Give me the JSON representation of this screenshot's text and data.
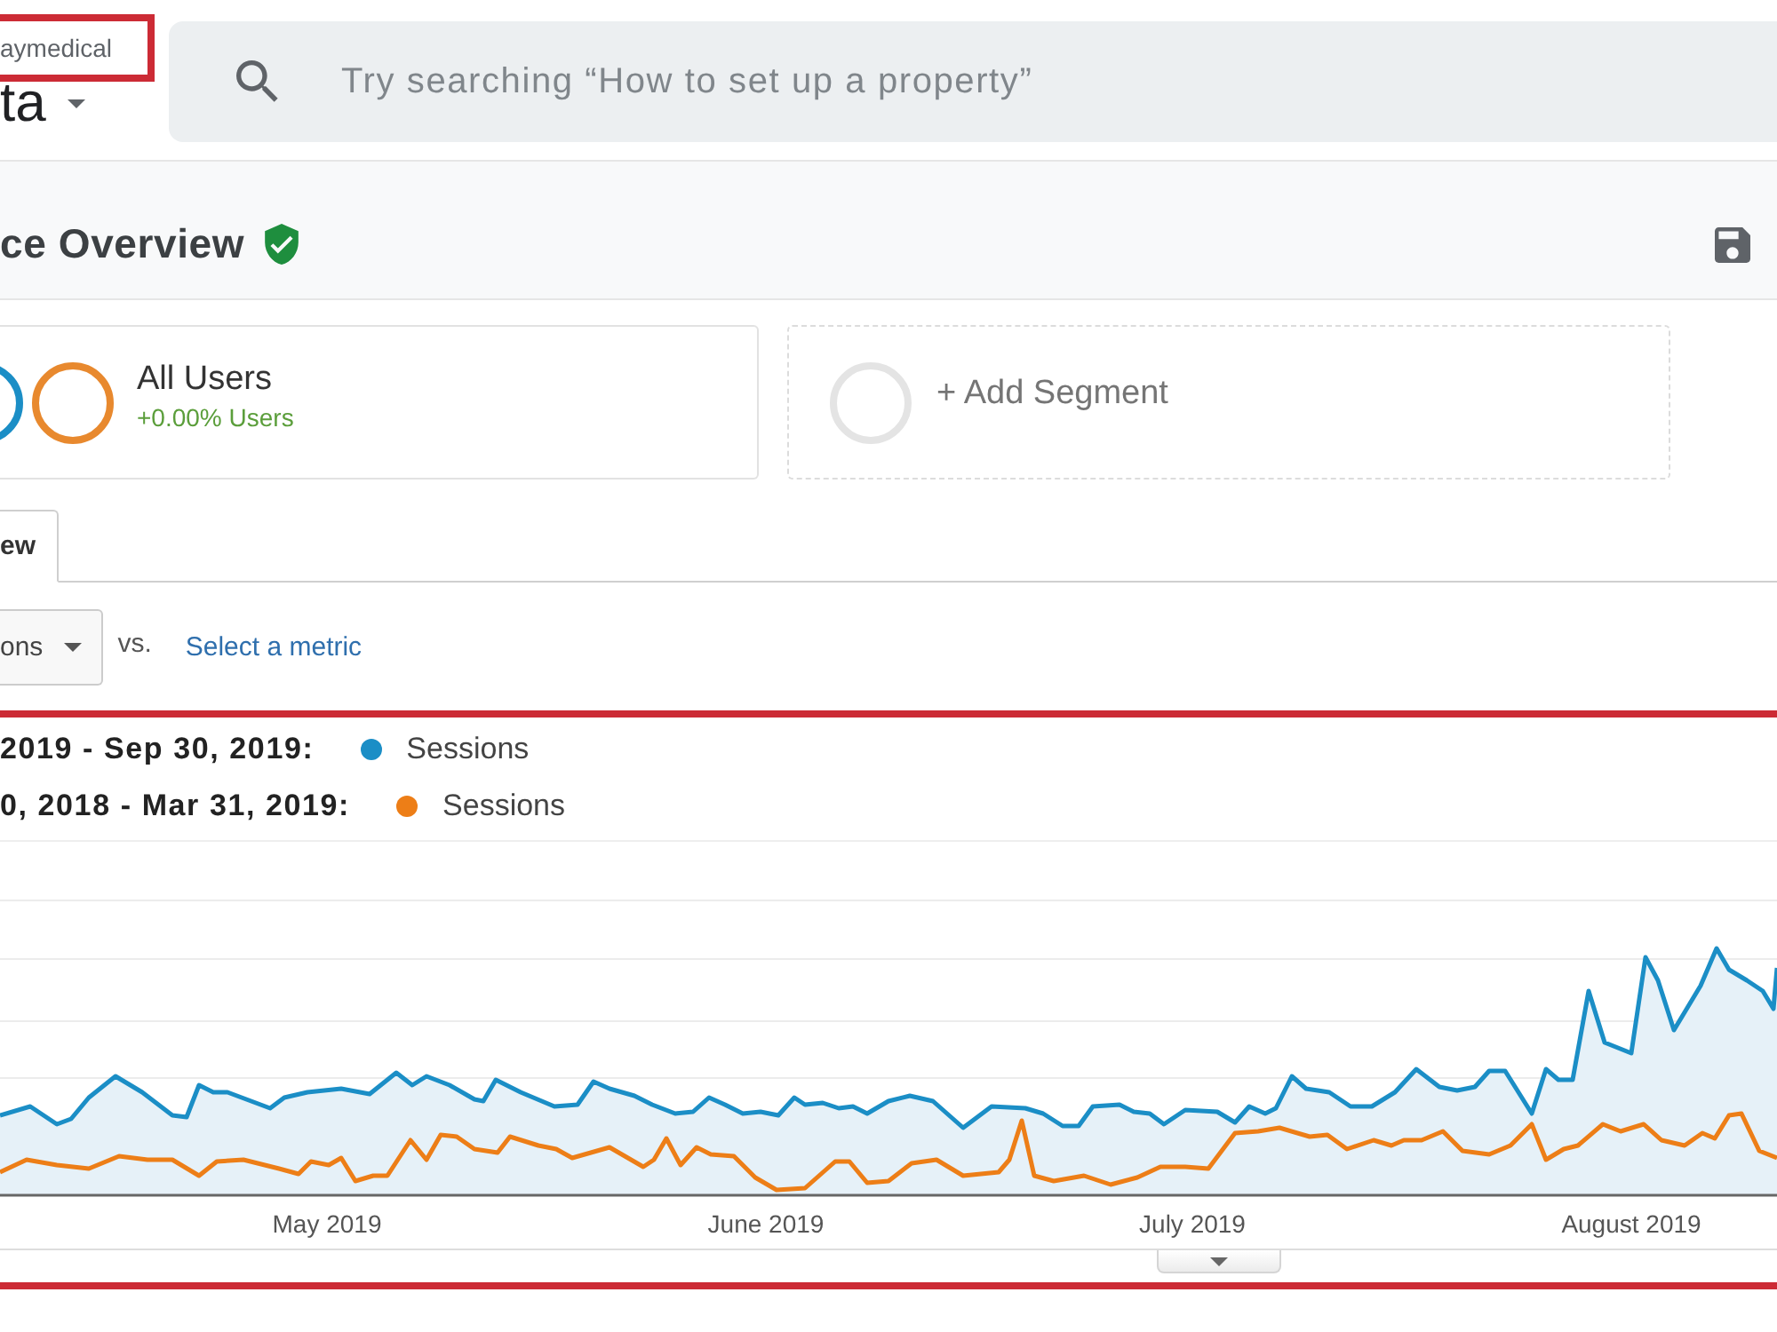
{
  "header": {
    "account": "aymedical",
    "property": "ta",
    "search": {
      "placeholder": "Try searching “How to set up a property”"
    }
  },
  "report": {
    "title": "ce Overview",
    "verified": true
  },
  "segments": [
    {
      "kind": "applied",
      "name": "All Users",
      "detail": "+0.00% Users",
      "rings": [
        {
          "color": "#1b8ec6"
        },
        {
          "color": "#e8892e"
        }
      ]
    },
    {
      "kind": "add",
      "label": "+ Add Segment"
    }
  ],
  "tabs": [
    {
      "label": "ew",
      "selected": true
    }
  ],
  "metric": {
    "primary": "ons",
    "vs": "vs.",
    "secondary": "Select a metric"
  },
  "legend": [
    {
      "range": "2019 - Sep 30, 2019:",
      "color": "#1b8ec6",
      "metric": "Sessions"
    },
    {
      "range": "0, 2018 - Mar 31, 2019:",
      "color": "#ed7e17",
      "metric": "Sessions"
    }
  ],
  "chart": {
    "x_labels": [
      "May 2019",
      "June 2019",
      "July 2019",
      "August 2019"
    ]
  }
}
